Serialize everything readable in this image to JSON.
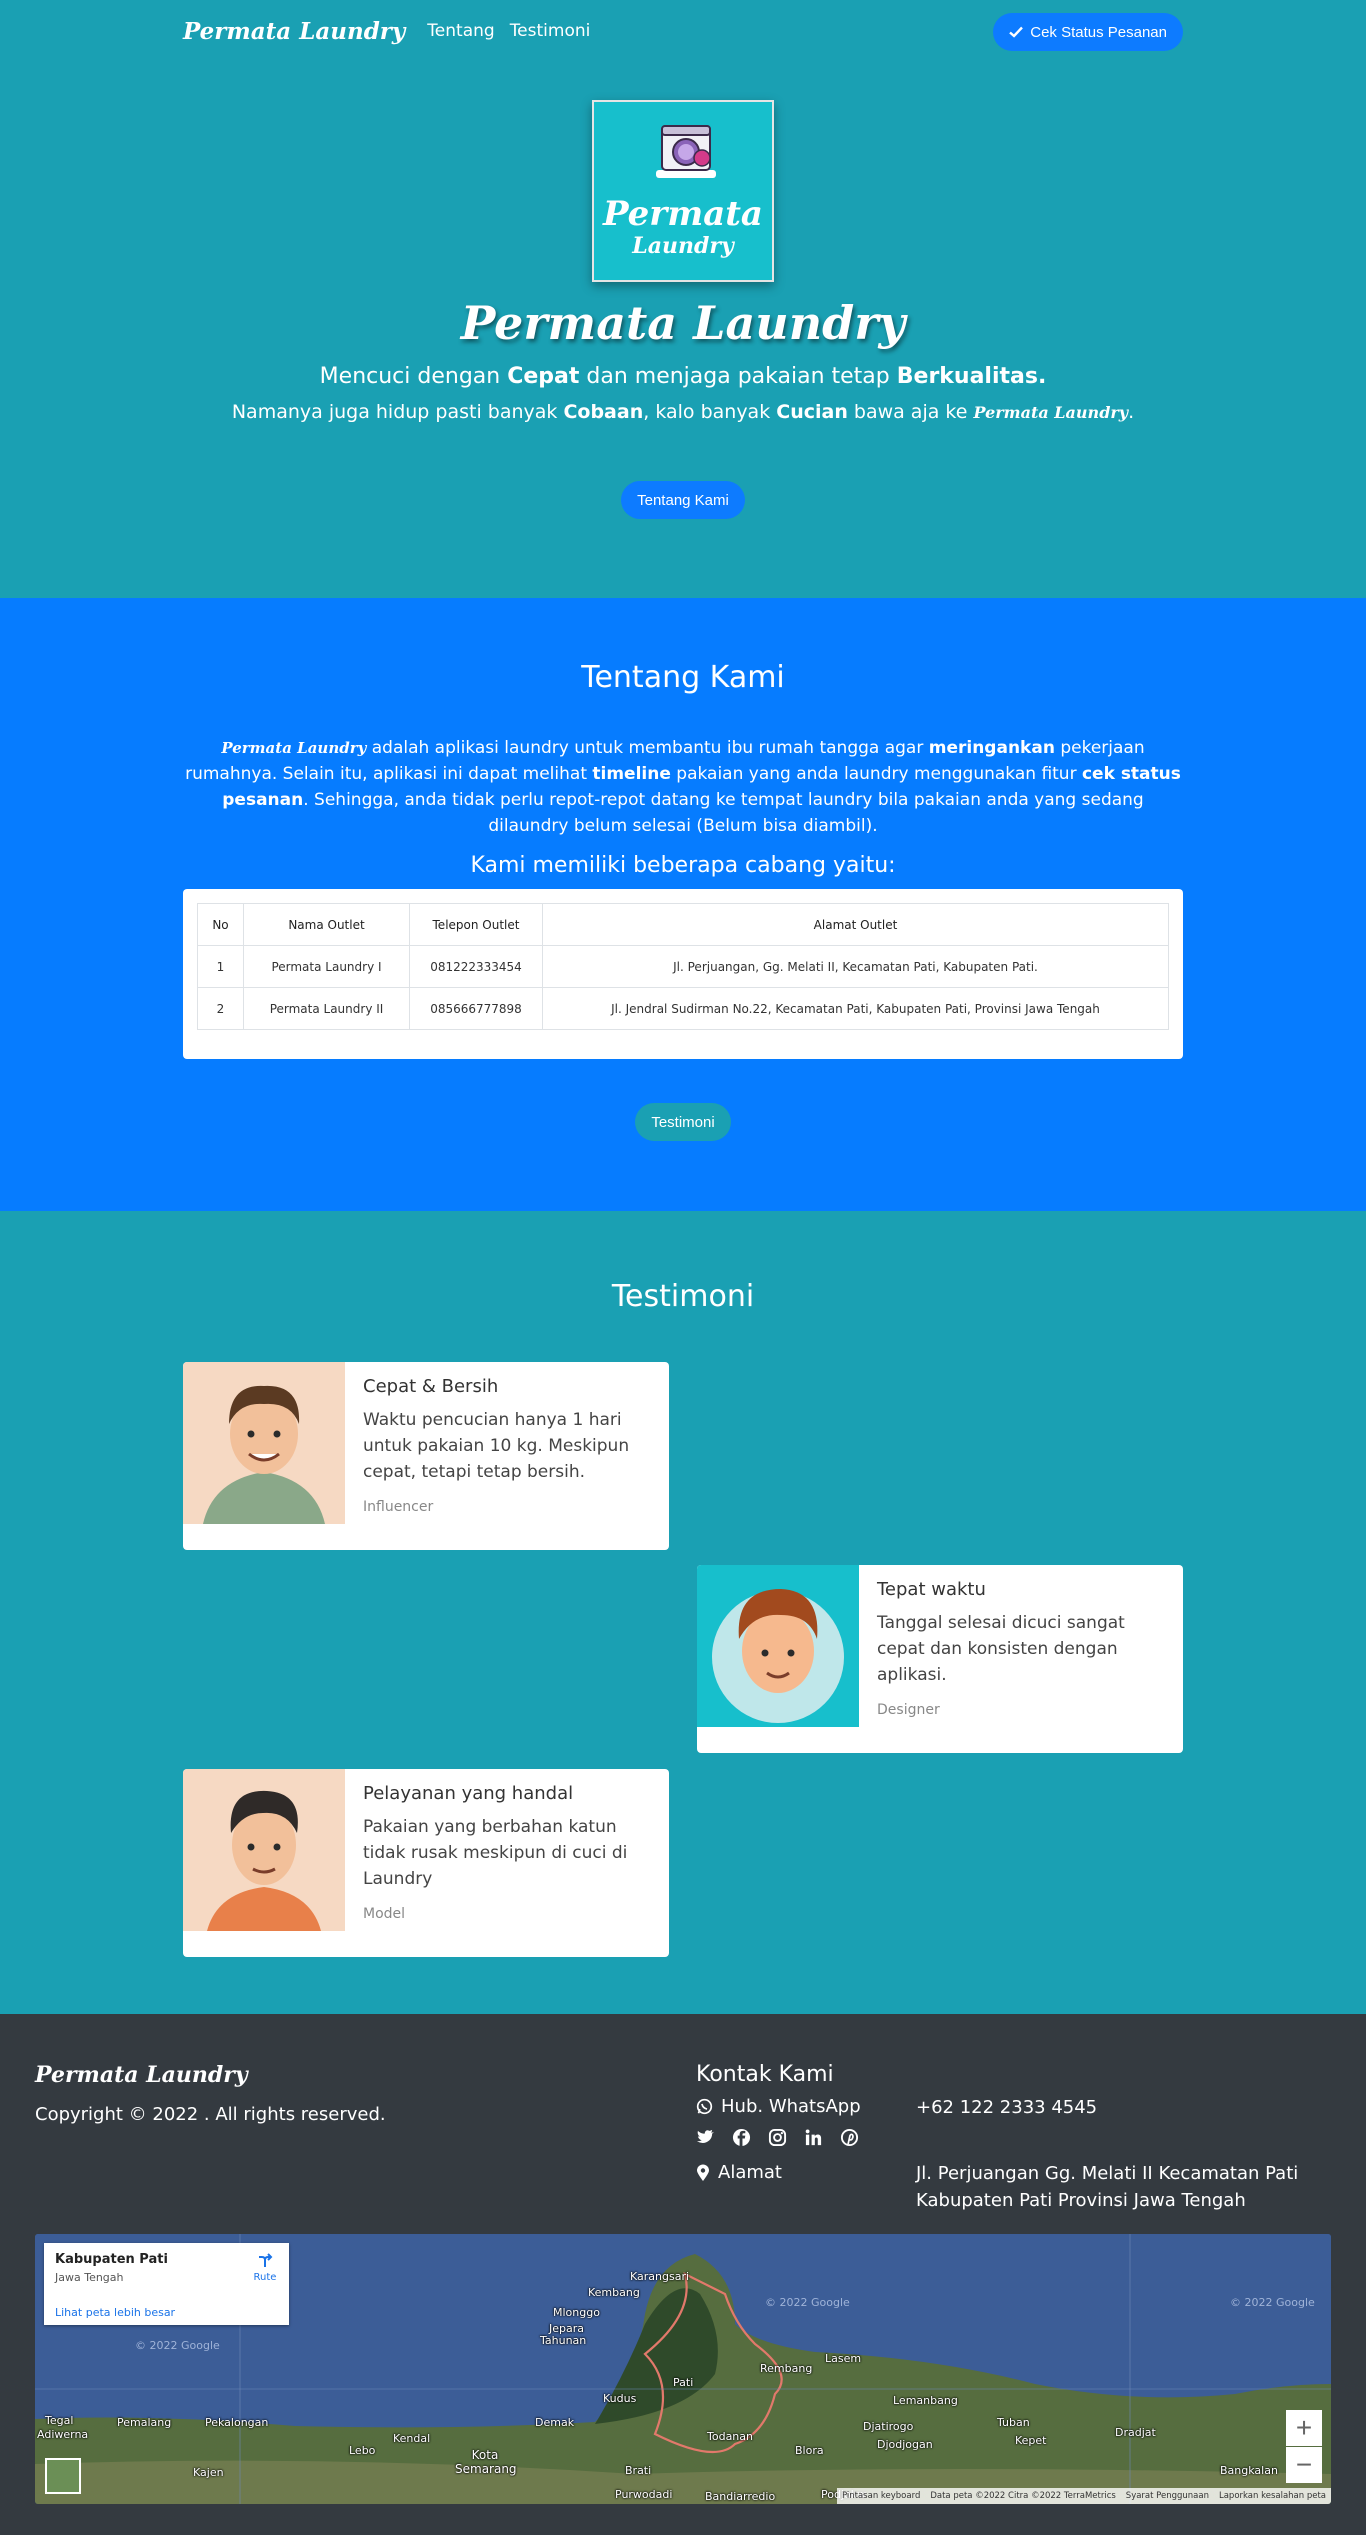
{
  "nav": {
    "brand": "Permata Laundry",
    "links": [
      "Tentang",
      "Testimoni"
    ],
    "status_button": "Cek Status Pesanan"
  },
  "hero": {
    "logo_line1": "Permata",
    "logo_line2": "Laundry",
    "title": "Permata Laundry",
    "line1": {
      "p1": "Mencuci dengan ",
      "b1": "Cepat",
      "p2": " dan menjaga pakaian tetap ",
      "b2": "Berkualitas."
    },
    "line2": {
      "p1": "Namanya juga hidup pasti banyak ",
      "b1": "Cobaan",
      "p2": ", kalo banyak ",
      "b2": "Cucian",
      "p3": " bawa aja ke ",
      "brand": "Permata Laundry",
      "p4": "."
    },
    "button": "Tentang Kami"
  },
  "about": {
    "title": "Tentang Kami",
    "text": {
      "brand": "Permata Laundry",
      "p1": " adalah aplikasi laundry untuk membantu ibu rumah tangga agar ",
      "b1": "meringankan",
      "p2": " pekerjaan rumahnya. Selain itu, aplikasi ini dapat melihat ",
      "b2": "timeline",
      "p3": " pakaian yang anda laundry menggunakan fitur ",
      "b3": "cek status pesanan",
      "p4": ". Sehingga, anda tidak perlu repot-repot datang ke tempat laundry bila pakaian anda yang sedang dilaundry belum selesai (Belum bisa diambil)."
    },
    "subtitle": "Kami memiliki beberapa cabang yaitu:",
    "table": {
      "headers": [
        "No",
        "Nama Outlet",
        "Telepon Outlet",
        "Alamat Outlet"
      ],
      "rows": [
        [
          "1",
          "Permata Laundry I",
          "081222333454",
          "Jl. Perjuangan, Gg. Melati II, Kecamatan Pati, Kabupaten Pati."
        ],
        [
          "2",
          "Permata Laundry II",
          "085666777898",
          "Jl. Jendral Sudirman No.22, Kecamatan Pati, Kabupaten Pati, Provinsi Jawa Tengah"
        ]
      ]
    },
    "button": "Testimoni"
  },
  "testimoni": {
    "title": "Testimoni",
    "cards": [
      {
        "title": "Cepat & Bersih",
        "text": "Waktu pencucian hanya 1 hari untuk pakaian 10 kg. Meskipun cepat, tetapi tetap bersih.",
        "role": "Influencer"
      },
      {
        "title": "Tepat waktu",
        "text": "Tanggal selesai dicuci sangat cepat dan konsisten dengan aplikasi.",
        "role": "Designer"
      },
      {
        "title": "Pelayanan yang handal",
        "text": "Pakaian yang berbahan katun tidak rusak meskipun di cuci di Laundry",
        "role": "Model"
      }
    ]
  },
  "footer": {
    "brand": "Permata Laundry",
    "copyright": "Copyright © 2022 . All rights reserved.",
    "contact_title": "Kontak Kami",
    "whatsapp_label": "Hub. WhatsApp",
    "whatsapp_value": "+62 122 2333 4545",
    "address_label": "Alamat",
    "address_line1": "Jl. Perjuangan Gg. Melati II Kecamatan Pati",
    "address_line2": "Kabupaten Pati Provinsi Jawa Tengah",
    "social_icons": [
      "twitter-icon",
      "facebook-icon",
      "instagram-icon",
      "linkedin-icon",
      "pinterest-icon"
    ]
  },
  "map": {
    "place": "Kabupaten Pati",
    "region": "Jawa Tengah",
    "route": "Rute",
    "larger_link": "Lihat peta lebih besar",
    "zoom_in": "+",
    "zoom_out": "−",
    "watermark": "© 2022 Google",
    "attribution": [
      "Pintasan keyboard",
      "Data peta ©2022 Citra ©2022 TerraMetrics",
      "Syarat Penggunaan",
      "Laporkan kesalahan peta"
    ],
    "labels": [
      "Karangsari",
      "Kembang",
      "Mlonggo",
      "Jepara",
      "Tahunan",
      "Rembang",
      "Pati",
      "Kudus",
      "Lasem",
      "Lemanbang",
      "Tuban",
      "Dradjat",
      "Tegal",
      "Adiwerna",
      "Pemalang",
      "Pekalongan",
      "Lebo",
      "Kendal",
      "Demak",
      "Kota Semarang",
      "Kajen",
      "Todanan",
      "Blora",
      "Djatirogo",
      "Djodjogan",
      "Kepet",
      "Bangkalan",
      "Purwodadi",
      "Brati",
      "Bandiarredio",
      "Podjokw"
    ]
  }
}
